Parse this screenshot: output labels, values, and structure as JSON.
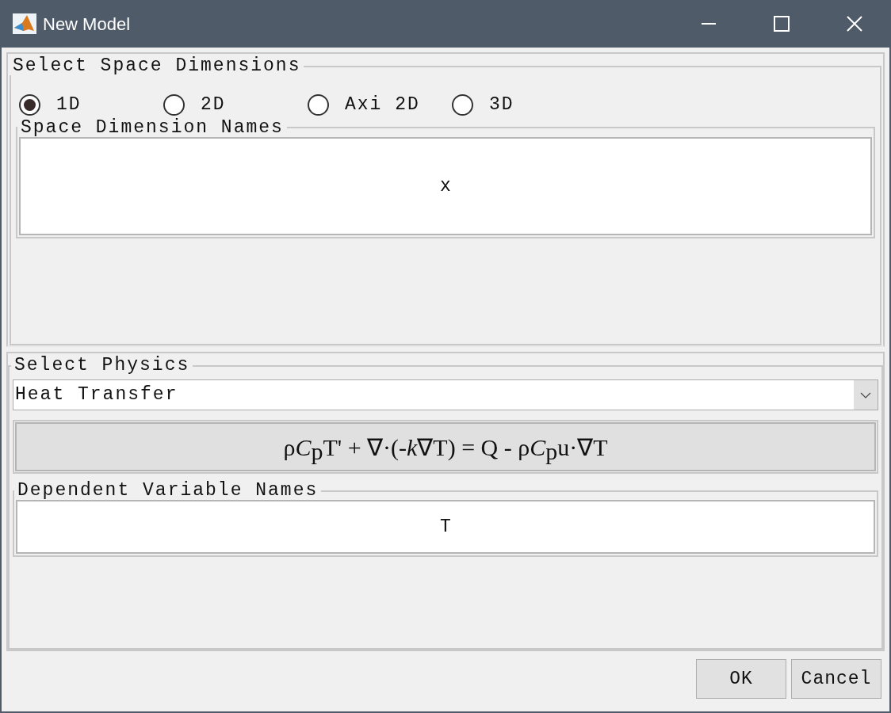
{
  "window": {
    "title": "New Model"
  },
  "space_dimensions": {
    "title": "Select Space Dimensions",
    "options": [
      {
        "label": "1D",
        "selected": true
      },
      {
        "label": "2D",
        "selected": false
      },
      {
        "label": "Axi 2D",
        "selected": false
      },
      {
        "label": "3D",
        "selected": false
      }
    ]
  },
  "space_dimension_names": {
    "title": "Space Dimension Names",
    "value": "x"
  },
  "physics": {
    "title": "Select Physics",
    "value": "Heat Transfer",
    "equation": [
      {
        "text": "ρ",
        "kind": "plain"
      },
      {
        "text": "C",
        "kind": "italic"
      },
      {
        "text": "p",
        "kind": "sub"
      },
      {
        "text": "T' + ∇·(-",
        "kind": "plain"
      },
      {
        "text": "k",
        "kind": "italic"
      },
      {
        "text": "∇T) = Q - ρ",
        "kind": "plain"
      },
      {
        "text": "C",
        "kind": "italic"
      },
      {
        "text": "p",
        "kind": "sub"
      },
      {
        "text": "u·∇T",
        "kind": "plain"
      }
    ]
  },
  "dependent_variable_names": {
    "title": "Dependent Variable Names",
    "value": "T"
  },
  "buttons": [
    "OK",
    "Cancel"
  ]
}
